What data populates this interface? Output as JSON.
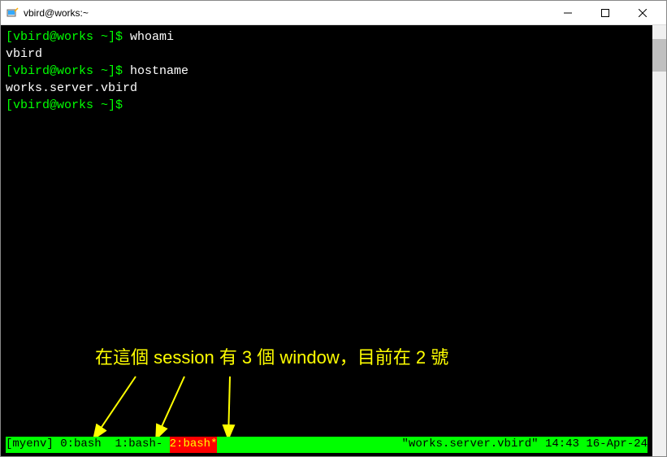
{
  "window": {
    "title": "vbird@works:~"
  },
  "terminal": {
    "lines": [
      {
        "prompt": "[vbird@works ~]$ ",
        "cmd": "whoami"
      },
      {
        "output": "vbird"
      },
      {
        "prompt": "[vbird@works ~]$ ",
        "cmd": "hostname"
      },
      {
        "output": "works.server.vbird"
      },
      {
        "prompt": "[vbird@works ~]$ ",
        "cmd": ""
      }
    ]
  },
  "annotation": {
    "text": "在這個 session 有 3 個 window，目前在 2 號"
  },
  "statusbar": {
    "session": "[myenv]",
    "windows": [
      {
        "label": "0:bash ",
        "active": false
      },
      {
        "label": "1:bash-",
        "active": false
      },
      {
        "label": "2:bash*",
        "active": true
      }
    ],
    "hostname": "\"works.server.vbird\"",
    "time": "14:43",
    "date": "16-Apr-24"
  }
}
